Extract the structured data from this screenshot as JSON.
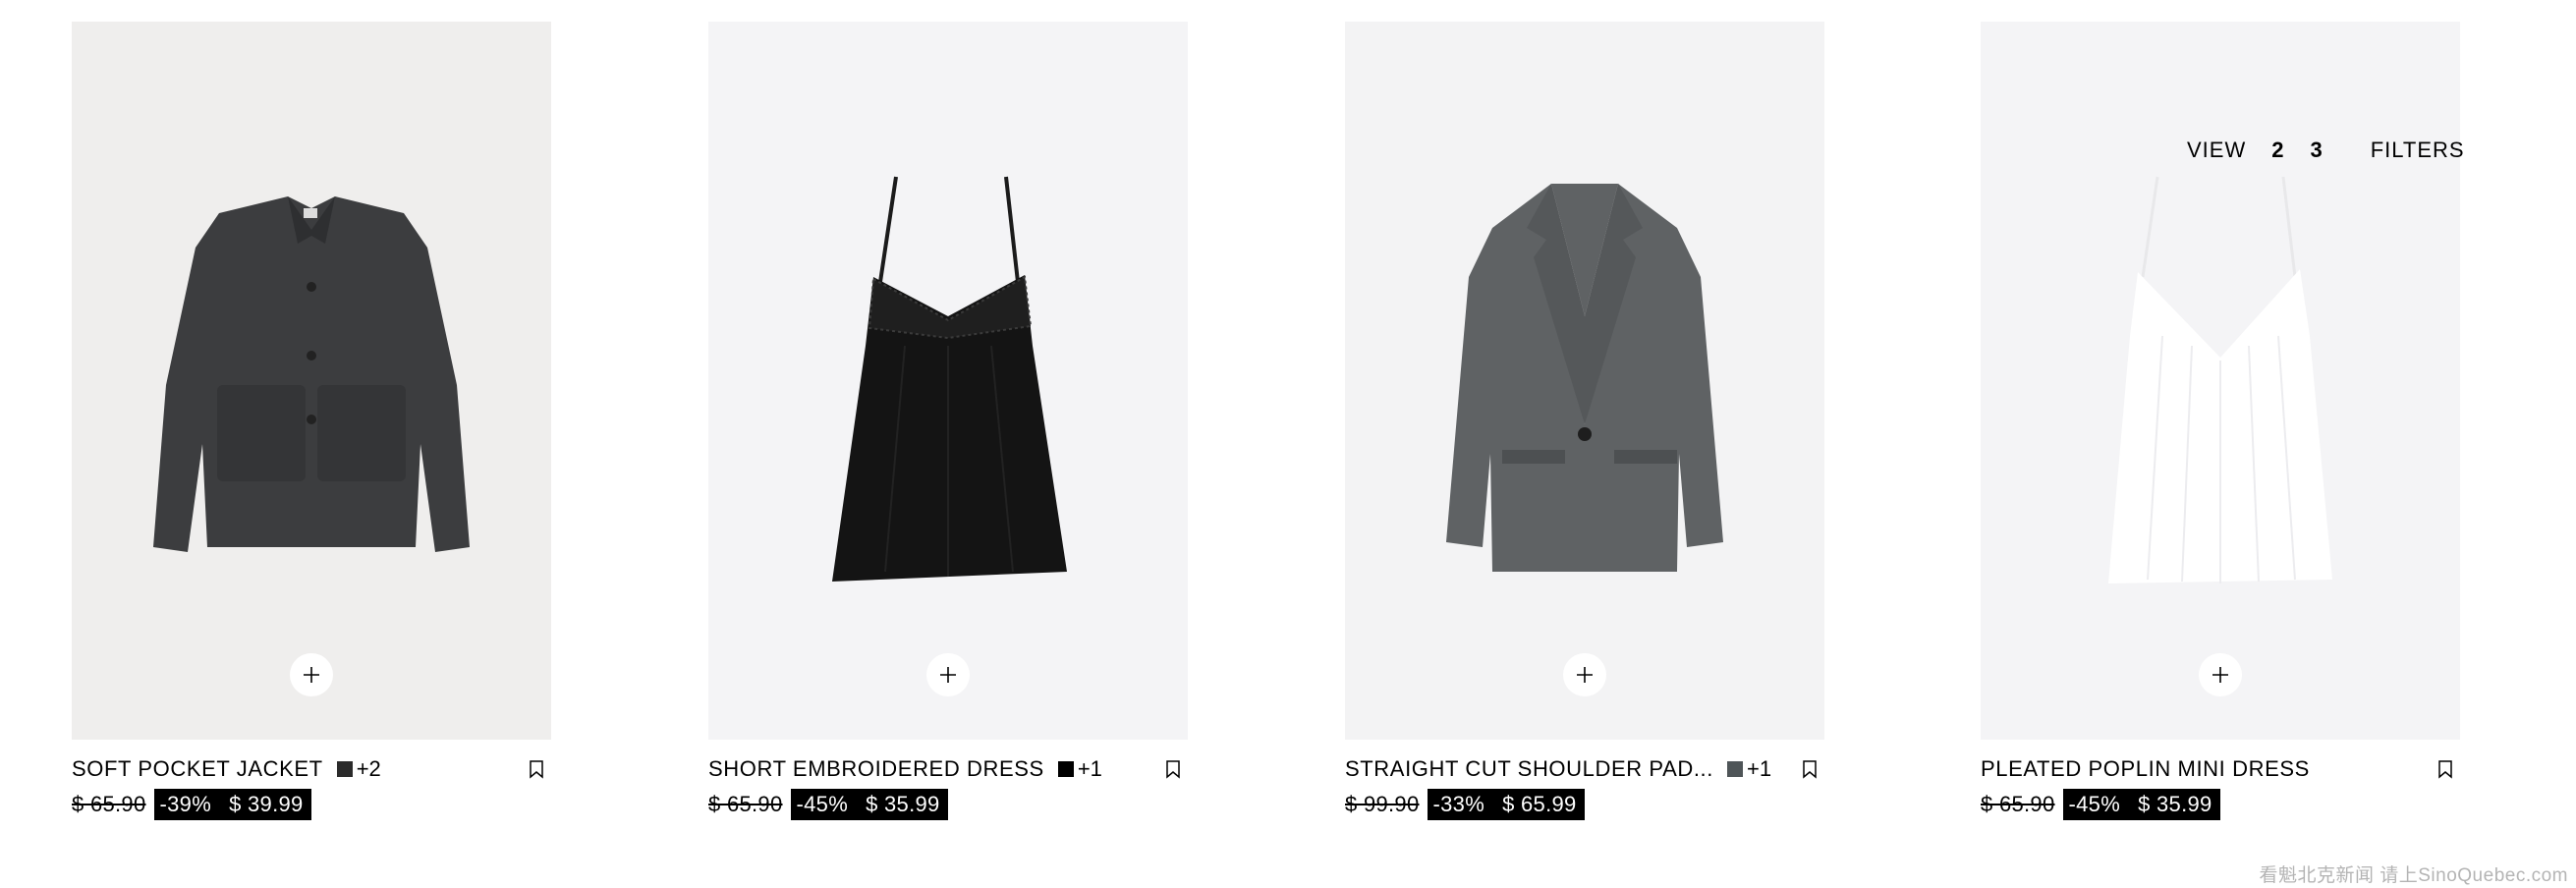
{
  "view_controls": {
    "label": "VIEW",
    "options": [
      "2",
      "3"
    ],
    "active": "2",
    "filters_label": "FILTERS"
  },
  "products": [
    {
      "name": "SOFT POCKET JACKET",
      "swatch_color": "#2b2b2b",
      "color_count": "+2",
      "old_price": "$ 65.90",
      "discount": "-39%",
      "sale_price": "$ 39.99",
      "background": "#efeeed",
      "image_icon": "jacket-image"
    },
    {
      "name": "SHORT EMBROIDERED DRESS",
      "swatch_color": "#000000",
      "color_count": "+1",
      "old_price": "$ 65.90",
      "discount": "-45%",
      "sale_price": "$ 35.99",
      "background": "#f4f4f6",
      "image_icon": "dress-image"
    },
    {
      "name": "STRAIGHT CUT SHOULDER PAD...",
      "swatch_color": "#4f5558",
      "color_count": "+1",
      "old_price": "$ 99.90",
      "discount": "-33%",
      "sale_price": "$ 65.99",
      "background": "#f3f3f4",
      "image_icon": "blazer-image"
    },
    {
      "name": "PLEATED POPLIN MINI DRESS",
      "swatch_color": "",
      "color_count": "",
      "old_price": "$ 65.90",
      "discount": "-45%",
      "sale_price": "$ 35.99",
      "background": "#f4f4f6",
      "image_icon": "white-dress-image"
    }
  ],
  "watermark": "看魁北克新闻 请上SinoQuebec.com"
}
